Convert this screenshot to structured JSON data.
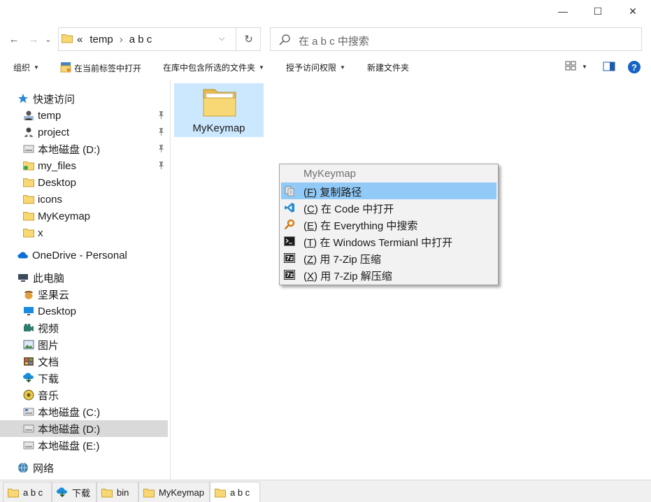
{
  "window": {
    "minimize_glyph": "—",
    "maximize_glyph": "☐",
    "close_glyph": "✕"
  },
  "nav": {
    "back_glyph": "←",
    "forward_glyph": "→",
    "recent_glyph": "⌄",
    "up_glyph": "↑"
  },
  "address": {
    "overflow": "«",
    "segments": [
      "temp",
      "a b c"
    ],
    "separator": "›",
    "dropdown_glyph": "⌵",
    "refresh_glyph": "↻"
  },
  "search": {
    "placeholder": "在 a b c 中搜索",
    "icon": "search-icon"
  },
  "commands": {
    "organize": "组织",
    "open_in_tab": "在当前标签中打开",
    "include_in_library": "在库中包含所选的文件夹",
    "grant_access": "授予访问权限",
    "new_folder": "新建文件夹",
    "caret": "▼",
    "help": "?"
  },
  "sidebar": {
    "quick_access": "快速访问",
    "quick_items": [
      "temp",
      "project",
      "本地磁盘 (D:)",
      "my_files",
      "Desktop",
      "icons",
      "MyKeymap",
      "x"
    ],
    "pin_glyph": "📌",
    "onedrive": "OneDrive - Personal",
    "this_pc": "此电脑",
    "pc_items": [
      "坚果云",
      "Desktop",
      "视频",
      "图片",
      "文档",
      "下载",
      "音乐",
      "本地磁盘 (C:)",
      "本地磁盘 (D:)",
      "本地磁盘 (E:)"
    ],
    "network": "网络"
  },
  "content": {
    "folder_name": "MyKeymap"
  },
  "context_menu": {
    "title": "MyKeymap",
    "items": [
      {
        "key": "F",
        "text": "复制路径",
        "icon": "copy-path-icon"
      },
      {
        "key": "C",
        "text": "在 Code 中打开",
        "icon": "vscode-icon"
      },
      {
        "key": "E",
        "text": "在 Everything 中搜索",
        "icon": "everything-search-icon"
      },
      {
        "key": "T",
        "text": "在 Windows Termianl 中打开",
        "icon": "terminal-icon"
      },
      {
        "key": "Z",
        "text": "用 7-Zip 压缩",
        "icon": "7zip-icon"
      },
      {
        "key": "X",
        "text": "用 7-Zip 解压缩",
        "icon": "7zip-icon"
      }
    ]
  },
  "tabs": [
    "a b c",
    "下载",
    "bin",
    "MyKeymap",
    "a b c"
  ],
  "colors": {
    "selection": "#cce8ff",
    "menu_highlight": "#91c9f7",
    "folder": "#f8d775",
    "accent": "#0067c0"
  }
}
